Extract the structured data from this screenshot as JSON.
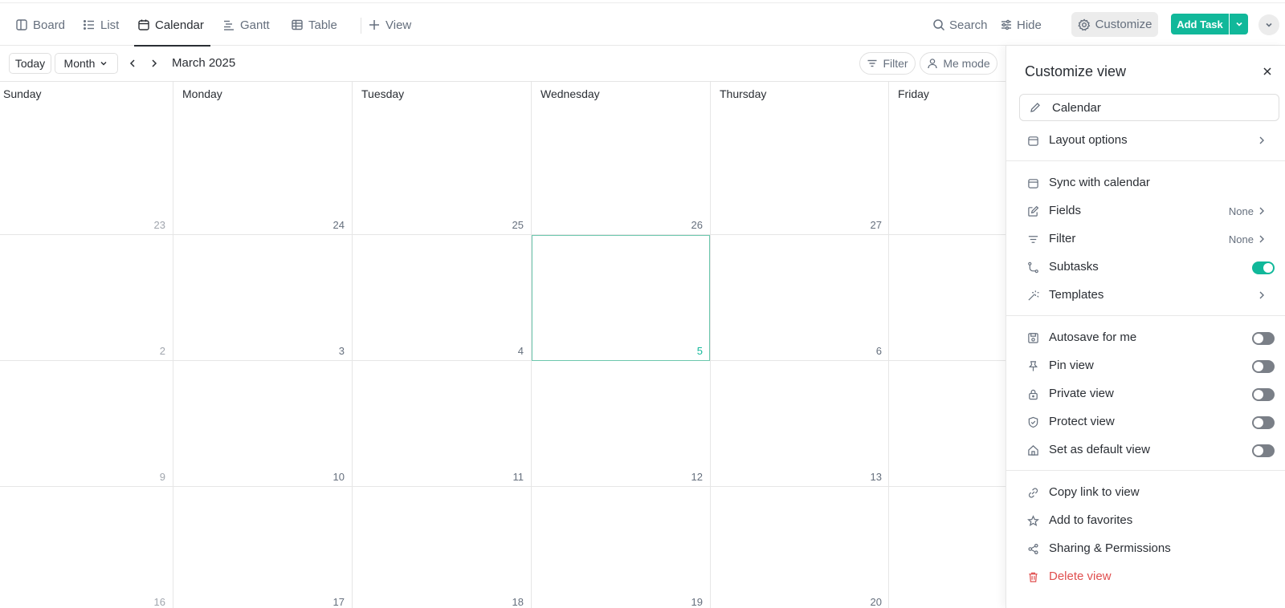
{
  "views": {
    "tabs": [
      {
        "label": "Board"
      },
      {
        "label": "List"
      },
      {
        "label": "Calendar"
      },
      {
        "label": "Gantt"
      },
      {
        "label": "Table"
      }
    ],
    "add_view": "View"
  },
  "toolbar": {
    "search": "Search",
    "hide": "Hide",
    "customize": "Customize",
    "add_task": "Add Task"
  },
  "calendar": {
    "today": "Today",
    "mode": "Month",
    "title": "March 2025",
    "filter": "Filter",
    "me_mode": "Me mode",
    "weekdays": [
      "Sunday",
      "Monday",
      "Tuesday",
      "Wednesday",
      "Thursday",
      "Friday"
    ],
    "weeks": [
      [
        "23",
        "24",
        "25",
        "26",
        "27"
      ],
      [
        "2",
        "3",
        "4",
        "5",
        "6"
      ],
      [
        "9",
        "10",
        "11",
        "12",
        "13"
      ],
      [
        "16",
        "17",
        "18",
        "19",
        "20"
      ]
    ],
    "today_date": "5"
  },
  "panel": {
    "title": "Customize view",
    "view_name": "Calendar",
    "layout_options": "Layout options",
    "sync": "Sync with calendar",
    "fields": {
      "label": "Fields",
      "value": "None"
    },
    "filter": {
      "label": "Filter",
      "value": "None"
    },
    "subtasks": {
      "label": "Subtasks",
      "enabled": true
    },
    "templates": "Templates",
    "autosave": {
      "label": "Autosave for me",
      "enabled": false
    },
    "pin": {
      "label": "Pin view",
      "enabled": false
    },
    "private": {
      "label": "Private view",
      "enabled": false
    },
    "protect": {
      "label": "Protect view",
      "enabled": false
    },
    "default": {
      "label": "Set as default view",
      "enabled": false
    },
    "copy_link": "Copy link to view",
    "favorites": "Add to favorites",
    "sharing": "Sharing & Permissions",
    "delete": "Delete view"
  },
  "colors": {
    "accent": "#11b89a",
    "danger": "#e04f4f"
  }
}
